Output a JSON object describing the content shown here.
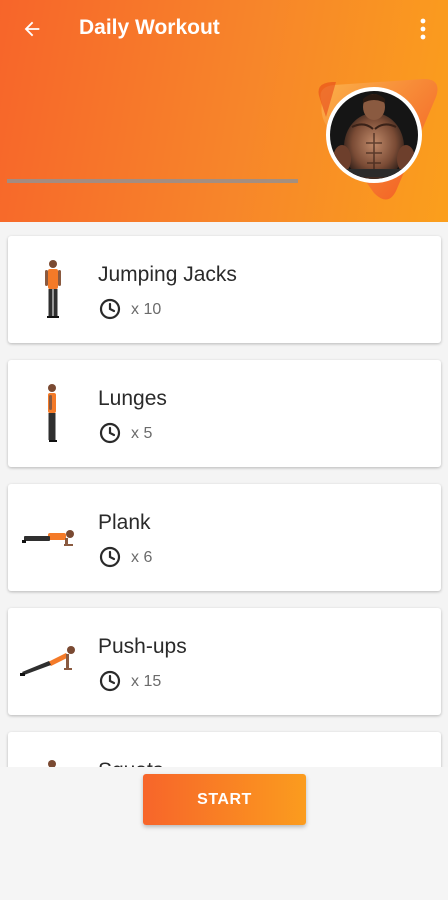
{
  "header": {
    "title": "Daily Workout",
    "back_icon": "arrow-left-icon",
    "menu_icon": "more-vert-icon",
    "progress_fraction": 0.0
  },
  "colors": {
    "accent_start": "#f7652a",
    "accent_end": "#fb9f1c",
    "text_primary": "#2a2a2a",
    "text_secondary": "#6b6b6b"
  },
  "exercises": [
    {
      "name": "Jumping Jacks",
      "reps": "x 10",
      "icon": "clock-icon"
    },
    {
      "name": "Lunges",
      "reps": "x 5",
      "icon": "clock-icon"
    },
    {
      "name": "Plank",
      "reps": "x 6",
      "icon": "clock-icon"
    },
    {
      "name": "Push-ups",
      "reps": "x 15",
      "icon": "clock-icon"
    },
    {
      "name": "Squats",
      "reps": "",
      "icon": "clock-icon"
    }
  ],
  "start_button": {
    "label": "START"
  }
}
